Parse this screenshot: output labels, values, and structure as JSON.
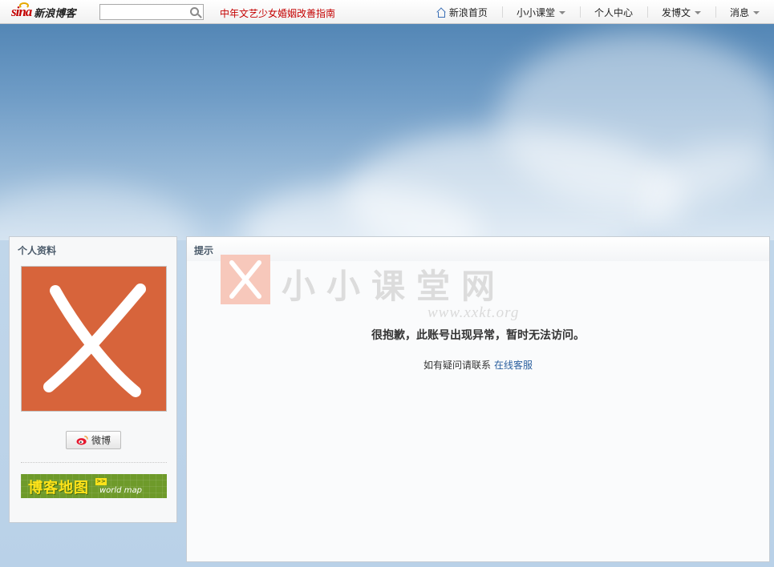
{
  "header": {
    "logo_brand": "sina",
    "logo_text": "新浪博客",
    "search_placeholder": "",
    "headline": "中年文艺少女婚姻改善指南",
    "nav": [
      {
        "label": "新浪首页",
        "icon": "home-icon"
      },
      {
        "label": "小小课堂",
        "dropdown": true
      },
      {
        "label": "个人中心"
      },
      {
        "label": "发博文",
        "dropdown": true
      },
      {
        "label": "消息",
        "dropdown": true
      }
    ]
  },
  "profile": {
    "title": "个人资料",
    "weibo_button": "微博",
    "blog_map": {
      "title": "博客地图",
      "arrow": ">>",
      "subtitle": "world map"
    }
  },
  "notice": {
    "title": "提示",
    "watermark_title": "小小课堂网",
    "watermark_url": "www.xxkt.org",
    "error_message": "很抱歉，此账号出现异常，暂时无法访问。",
    "contact_prefix": "如有疑问请联系",
    "contact_link": "在线客服"
  },
  "colors": {
    "accent_red": "#c40000",
    "avatar_bg": "#d7643b",
    "link_blue": "#2b5f9e",
    "blogmap_green": "#6e9a2a"
  }
}
